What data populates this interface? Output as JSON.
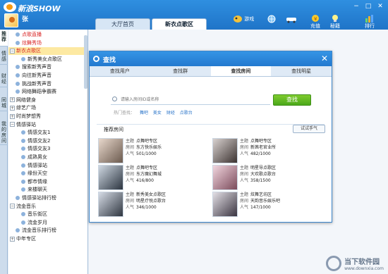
{
  "app": {
    "title": "新浪SHOW",
    "username": "张"
  },
  "window": {
    "minimize_icon": "−",
    "maximize_icon": "□",
    "close_icon": "✕"
  },
  "main_tabs": [
    {
      "label": "大厅首页",
      "active": false
    },
    {
      "label": "新衣点歌区",
      "active": true
    }
  ],
  "toolbar": {
    "items": [
      {
        "label": "游戏",
        "icon": "game-icon"
      },
      {
        "label": "",
        "icon": "globe-icon"
      },
      {
        "label": "",
        "icon": "car-icon"
      },
      {
        "label": "充值",
        "icon": "recharge-icon"
      },
      {
        "label": "秘籍",
        "icon": "tips-icon"
      },
      {
        "label": "排行",
        "icon": "ranking-icon"
      }
    ]
  },
  "side_tabs": [
    {
      "label": "推荐",
      "active": true
    },
    {
      "label": "情感",
      "active": false
    },
    {
      "label": "财经",
      "active": false
    },
    {
      "label": "同城",
      "active": false
    },
    {
      "label": "我的房间",
      "active": false
    }
  ],
  "sidebar": {
    "items": [
      {
        "label": "点歌直播",
        "style": "red",
        "indent": 1,
        "toggle": ""
      },
      {
        "label": "炫舞秀场",
        "style": "red",
        "indent": 1,
        "toggle": ""
      },
      {
        "label": "新衣点歌区",
        "style": "active-red",
        "indent": 0,
        "toggle": "−"
      },
      {
        "label": "新秀美女点歌区",
        "style": "normal",
        "indent": 2,
        "toggle": ""
      },
      {
        "label": "搜索新秀声音",
        "style": "normal",
        "indent": 1,
        "toggle": ""
      },
      {
        "label": "向往新秀声音",
        "style": "normal",
        "indent": 1,
        "toggle": ""
      },
      {
        "label": "挑战新秀声音",
        "style": "normal",
        "indent": 1,
        "toggle": ""
      },
      {
        "label": "网络舞蹈争霸赛",
        "style": "normal",
        "indent": 1,
        "toggle": ""
      },
      {
        "label": "网络健身",
        "style": "normal",
        "indent": 0,
        "toggle": "+"
      },
      {
        "label": "综艺广场",
        "style": "normal",
        "indent": 0,
        "toggle": "+"
      },
      {
        "label": "时尚梦想秀",
        "style": "normal",
        "indent": 0,
        "toggle": "+"
      },
      {
        "label": "情感驿站",
        "style": "normal",
        "indent": 0,
        "toggle": "−"
      },
      {
        "label": "情感交友1",
        "style": "normal",
        "indent": 2,
        "toggle": ""
      },
      {
        "label": "情感交友2",
        "style": "normal",
        "indent": 2,
        "toggle": ""
      },
      {
        "label": "情感交友3",
        "style": "normal",
        "indent": 2,
        "toggle": ""
      },
      {
        "label": "成熟男女",
        "style": "normal",
        "indent": 2,
        "toggle": ""
      },
      {
        "label": "情感驿站",
        "style": "normal",
        "indent": 2,
        "toggle": ""
      },
      {
        "label": "缘份天空",
        "style": "normal",
        "indent": 2,
        "toggle": ""
      },
      {
        "label": "都市情缘",
        "style": "normal",
        "indent": 2,
        "toggle": ""
      },
      {
        "label": "来楼聊天",
        "style": "normal",
        "indent": 2,
        "toggle": ""
      },
      {
        "label": "情感驿站排行榜",
        "style": "normal",
        "indent": 1,
        "toggle": ""
      },
      {
        "label": "流金音乐",
        "style": "normal",
        "indent": 0,
        "toggle": "−"
      },
      {
        "label": "音乐街区",
        "style": "normal",
        "indent": 2,
        "toggle": ""
      },
      {
        "label": "流金岁月",
        "style": "normal",
        "indent": 2,
        "toggle": ""
      },
      {
        "label": "流金音乐排行榜",
        "style": "normal",
        "indent": 1,
        "toggle": ""
      },
      {
        "label": "中年专区",
        "style": "normal",
        "indent": 0,
        "toggle": "+"
      }
    ]
  },
  "dialog": {
    "title": "查找",
    "close_label": "✕",
    "tabs": [
      {
        "label": "查找用户",
        "active": false
      },
      {
        "label": "查找群",
        "active": false
      },
      {
        "label": "查找房间",
        "active": true
      },
      {
        "label": "查找明星",
        "active": false
      }
    ],
    "search_placeholder": "请输入房间ID或名称",
    "search_button": "查找",
    "hot_label": "热门查找：",
    "hot_keywords": [
      "舞吧",
      "美女",
      "财经",
      "点歌台"
    ],
    "recommend_title": "推荐房间",
    "change_button": "试试手气",
    "room_labels": {
      "theme": "主题",
      "room": "房间",
      "popularity": "人气"
    },
    "rooms": [
      {
        "theme": "点舞吧专区",
        "room": "东方快乐娱乐",
        "popularity": "501/1000"
      },
      {
        "theme": "点舞吧专区",
        "room": "新茜老官业所",
        "popularity": "482/1000"
      },
      {
        "theme": "点舞吧专区",
        "room": "东方魔幻舞城",
        "popularity": "416/800"
      },
      {
        "theme": "明星导点歌区",
        "room": "大欢歌点歌台",
        "popularity": "358/1500"
      },
      {
        "theme": "新秀美女点歌区",
        "room": "明星疗悦点歌台",
        "popularity": "346/1000"
      },
      {
        "theme": "炫舞艺坊区",
        "room": "天韵音乐娱乐吧",
        "popularity": "147/1000"
      }
    ]
  },
  "watermark": {
    "title": "当下软件园",
    "subtitle": "www.downxia.com"
  }
}
